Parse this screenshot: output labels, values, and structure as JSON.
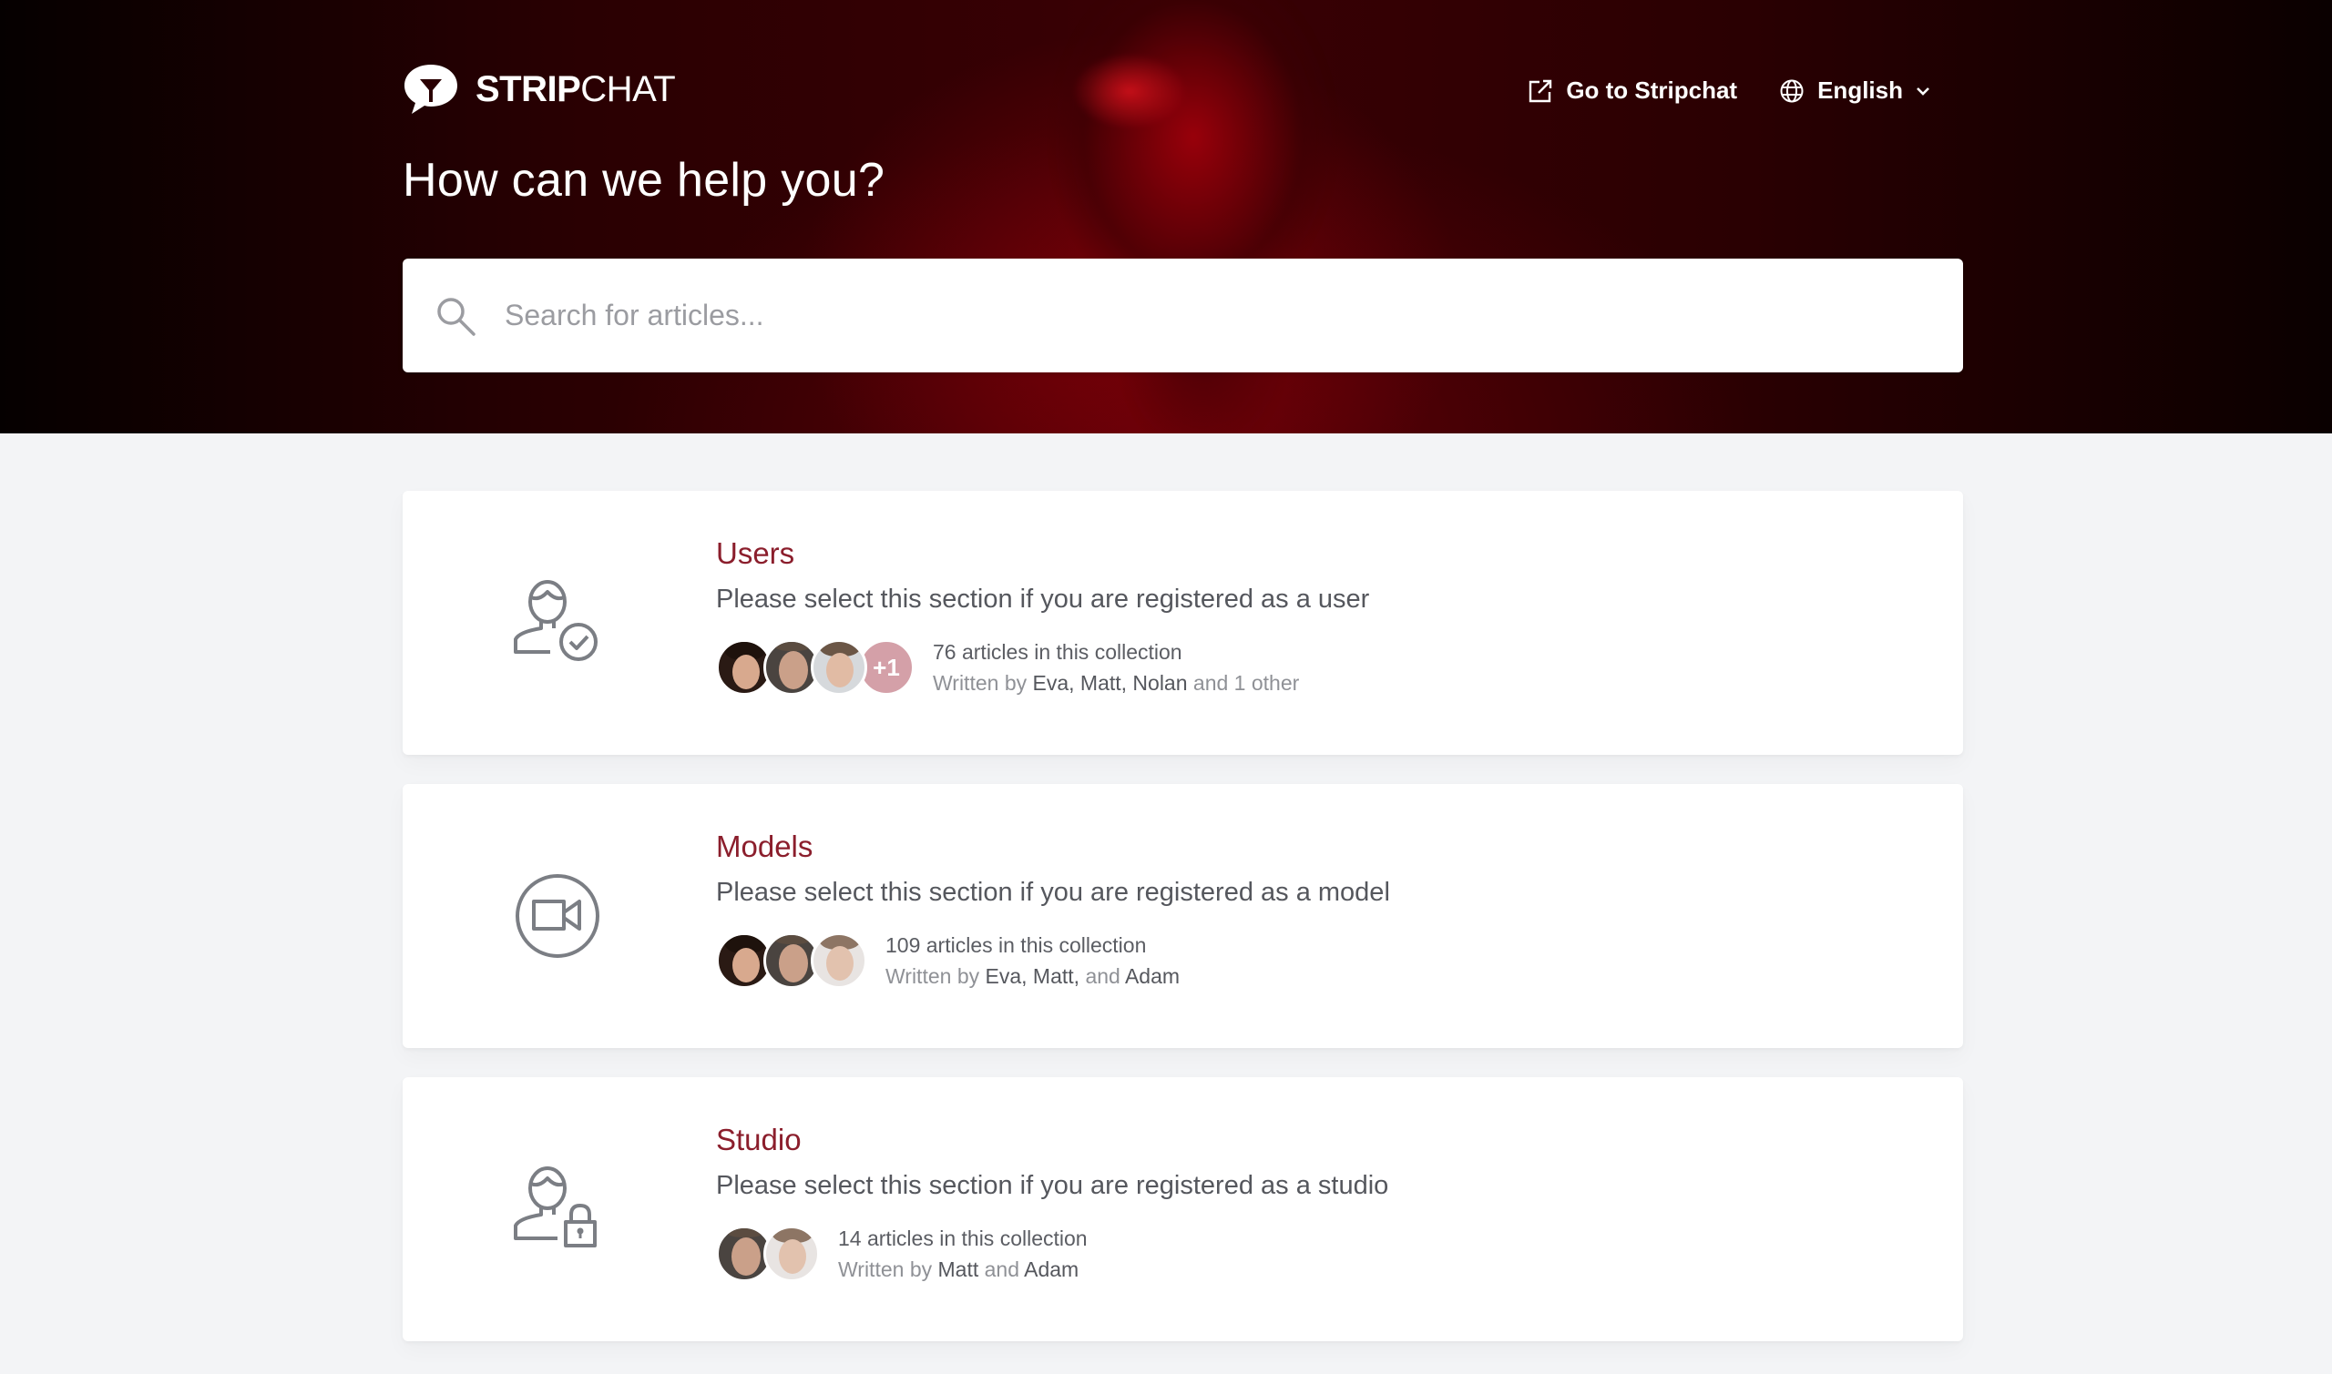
{
  "header": {
    "brand_bold": "STRIP",
    "brand_light": "CHAT",
    "go_to_label": "Go to Stripchat",
    "language_label": "English",
    "headline": "How can we help you?",
    "search_placeholder": "Search for articles..."
  },
  "colors": {
    "accent": "#8b1e2c",
    "hero_dark": "#2a0002",
    "more_badge": "#d4a0a8",
    "page_bg": "#f3f4f6"
  },
  "collections": [
    {
      "title": "Users",
      "description": "Please select this section if you are registered as a user",
      "icon": "user-check-icon",
      "article_count": "76 articles in this collection",
      "written_by_prefix": "Written by",
      "authors": [
        "Eva",
        "Matt",
        "Nolan"
      ],
      "authors_text": "Eva, Matt, Nolan",
      "suffix": "and 1 other",
      "more_badge": "+1"
    },
    {
      "title": "Models",
      "description": "Please select this section if you are registered as a model",
      "icon": "video-camera-icon",
      "article_count": "109 articles in this collection",
      "written_by_prefix": "Written by",
      "authors": [
        "Eva",
        "Matt",
        "Adam"
      ],
      "authors_text_a": "Eva, Matt,",
      "and": "and",
      "authors_text_b": "Adam"
    },
    {
      "title": "Studio",
      "description": "Please select this section if you are registered as a studio",
      "icon": "user-lock-icon",
      "article_count": "14 articles in this collection",
      "written_by_prefix": "Written by",
      "authors": [
        "Matt",
        "Adam"
      ],
      "authors_text_a": "Matt",
      "and": "and",
      "authors_text_b": "Adam"
    }
  ]
}
